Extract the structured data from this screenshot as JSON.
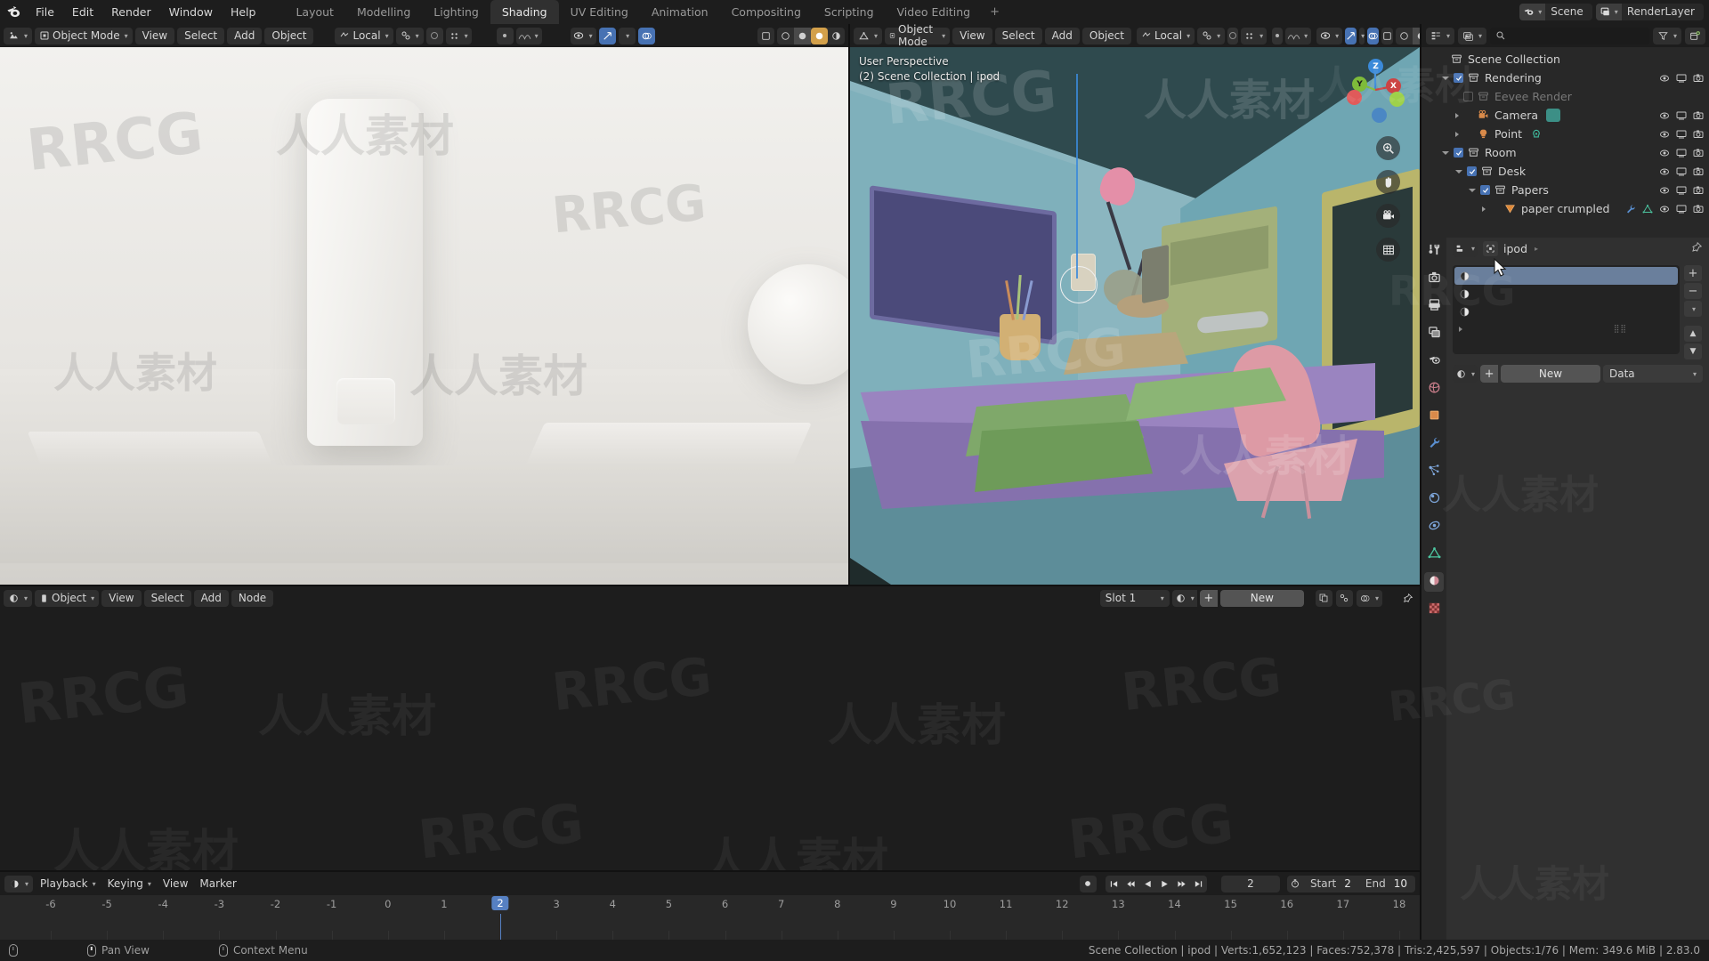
{
  "app": {
    "name": "Blender",
    "version_label": "2.83.0"
  },
  "topbar": {
    "menus": [
      "File",
      "Edit",
      "Render",
      "Window",
      "Help"
    ],
    "workspaces": [
      {
        "label": "Layout",
        "active": false
      },
      {
        "label": "Modelling",
        "active": false
      },
      {
        "label": "Lighting",
        "active": false
      },
      {
        "label": "Shading",
        "active": true
      },
      {
        "label": "UV Editing",
        "active": false
      },
      {
        "label": "Animation",
        "active": false
      },
      {
        "label": "Compositing",
        "active": false
      },
      {
        "label": "Scripting",
        "active": false
      },
      {
        "label": "Video Editing",
        "active": false
      }
    ],
    "add_workspace": "+",
    "scene_name": "Scene",
    "viewlayer_name": "RenderLayer"
  },
  "viewport_left": {
    "mode": "Object Mode",
    "menus": [
      "View",
      "Select",
      "Add",
      "Object"
    ],
    "orientation": "Local"
  },
  "viewport_right": {
    "mode": "Object Mode",
    "menus": [
      "View",
      "Select",
      "Add",
      "Object"
    ],
    "orientation": "Local",
    "overlay_line1": "User Perspective",
    "overlay_line2": "(2) Scene Collection | ipod",
    "gizmo_axes": [
      "X",
      "Y",
      "Z"
    ],
    "nav_buttons": [
      "zoom-icon",
      "hand-icon",
      "camera-icon",
      "grid-icon"
    ]
  },
  "shader_editor": {
    "shader_type": "Object",
    "menus": [
      "View",
      "Select",
      "Add",
      "Node"
    ],
    "slot": "Slot 1",
    "new_label": "New"
  },
  "timeline": {
    "menus": [
      "Playback",
      "Keying",
      "View",
      "Marker"
    ],
    "current_frame": "2",
    "start_label": "Start",
    "start_value": "2",
    "end_label": "End",
    "end_value": "10",
    "ticks": [
      "-6",
      "-5",
      "-4",
      "-3",
      "-2",
      "-1",
      "0",
      "1",
      "2",
      "3",
      "4",
      "5",
      "6",
      "7",
      "8",
      "9",
      "10",
      "11",
      "12",
      "13",
      "14",
      "15",
      "16",
      "17",
      "18"
    ]
  },
  "outliner": {
    "search_placeholder": "",
    "rows": [
      {
        "label": "Scene Collection",
        "indent": 0,
        "icon": "collection-icon",
        "disclosure": "none",
        "checkbox": "none",
        "dim": false,
        "selected": false,
        "restrict": false
      },
      {
        "label": "Rendering",
        "indent": 1,
        "icon": "collection-icon",
        "disclosure": "open",
        "checkbox": "on",
        "dim": false,
        "selected": false,
        "restrict": true
      },
      {
        "label": "Eevee Render",
        "indent": 2,
        "icon": "collection-icon",
        "disclosure": "none",
        "checkbox": "off",
        "dim": true,
        "selected": false,
        "restrict": false
      },
      {
        "label": "Camera",
        "indent": 2,
        "icon": "camera-obj-icon",
        "disclosure": "closed",
        "checkbox": "none",
        "dim": false,
        "selected": false,
        "restrict": true,
        "extra": "camera-data-icon"
      },
      {
        "label": "Point",
        "indent": 2,
        "icon": "light-obj-icon",
        "disclosure": "closed",
        "checkbox": "none",
        "dim": false,
        "selected": false,
        "restrict": true,
        "extra": "light-data-icon"
      },
      {
        "label": "Room",
        "indent": 1,
        "icon": "collection-icon",
        "disclosure": "open",
        "checkbox": "on",
        "dim": false,
        "selected": false,
        "restrict": true
      },
      {
        "label": "Desk",
        "indent": 2,
        "icon": "collection-icon",
        "disclosure": "open",
        "checkbox": "on",
        "dim": false,
        "selected": false,
        "restrict": true
      },
      {
        "label": "Papers",
        "indent": 3,
        "icon": "collection-icon",
        "disclosure": "open",
        "checkbox": "on",
        "dim": false,
        "selected": false,
        "restrict": true
      },
      {
        "label": "paper crumpled",
        "indent": 4,
        "icon": "mesh-obj-icon",
        "disclosure": "closed",
        "checkbox": "none",
        "dim": false,
        "selected": false,
        "restrict": true,
        "extra2": "modifier-icon",
        "extra3": "mesh-data-icon"
      }
    ]
  },
  "properties": {
    "breadcrumb_object": "ipod",
    "material_slots": [
      "",
      "",
      ""
    ],
    "new_label": "New",
    "data_label": "Data",
    "tabs": [
      "tool-icon",
      "render-icon",
      "output-icon",
      "viewlayer-icon",
      "scene-icon",
      "world-icon",
      "object-icon",
      "modifier-icon",
      "particles-icon",
      "physics-icon",
      "constraint-icon",
      "data-icon",
      "material-icon",
      "texture-icon"
    ],
    "active_tab": "material-icon"
  },
  "statusbar": {
    "hint_pan": "Pan View",
    "hint_context": "Context Menu",
    "stats": "Scene Collection | ipod | Verts:1,652,123 | Faces:752,378 | Tris:2,425,597 | Objects:1/76 | Mem: 349.6 MiB | 2.83.0"
  },
  "watermarks": {
    "latin": "RRCG",
    "cjk": "人人素材"
  },
  "colors": {
    "accent_blue": "#4772b3",
    "header_dark": "#1d1d1d",
    "panel": "#303030",
    "outliner_bg": "#282828",
    "axis_x": "#cc4444",
    "axis_y": "#7ebb3a",
    "axis_z": "#3b8ad9"
  }
}
